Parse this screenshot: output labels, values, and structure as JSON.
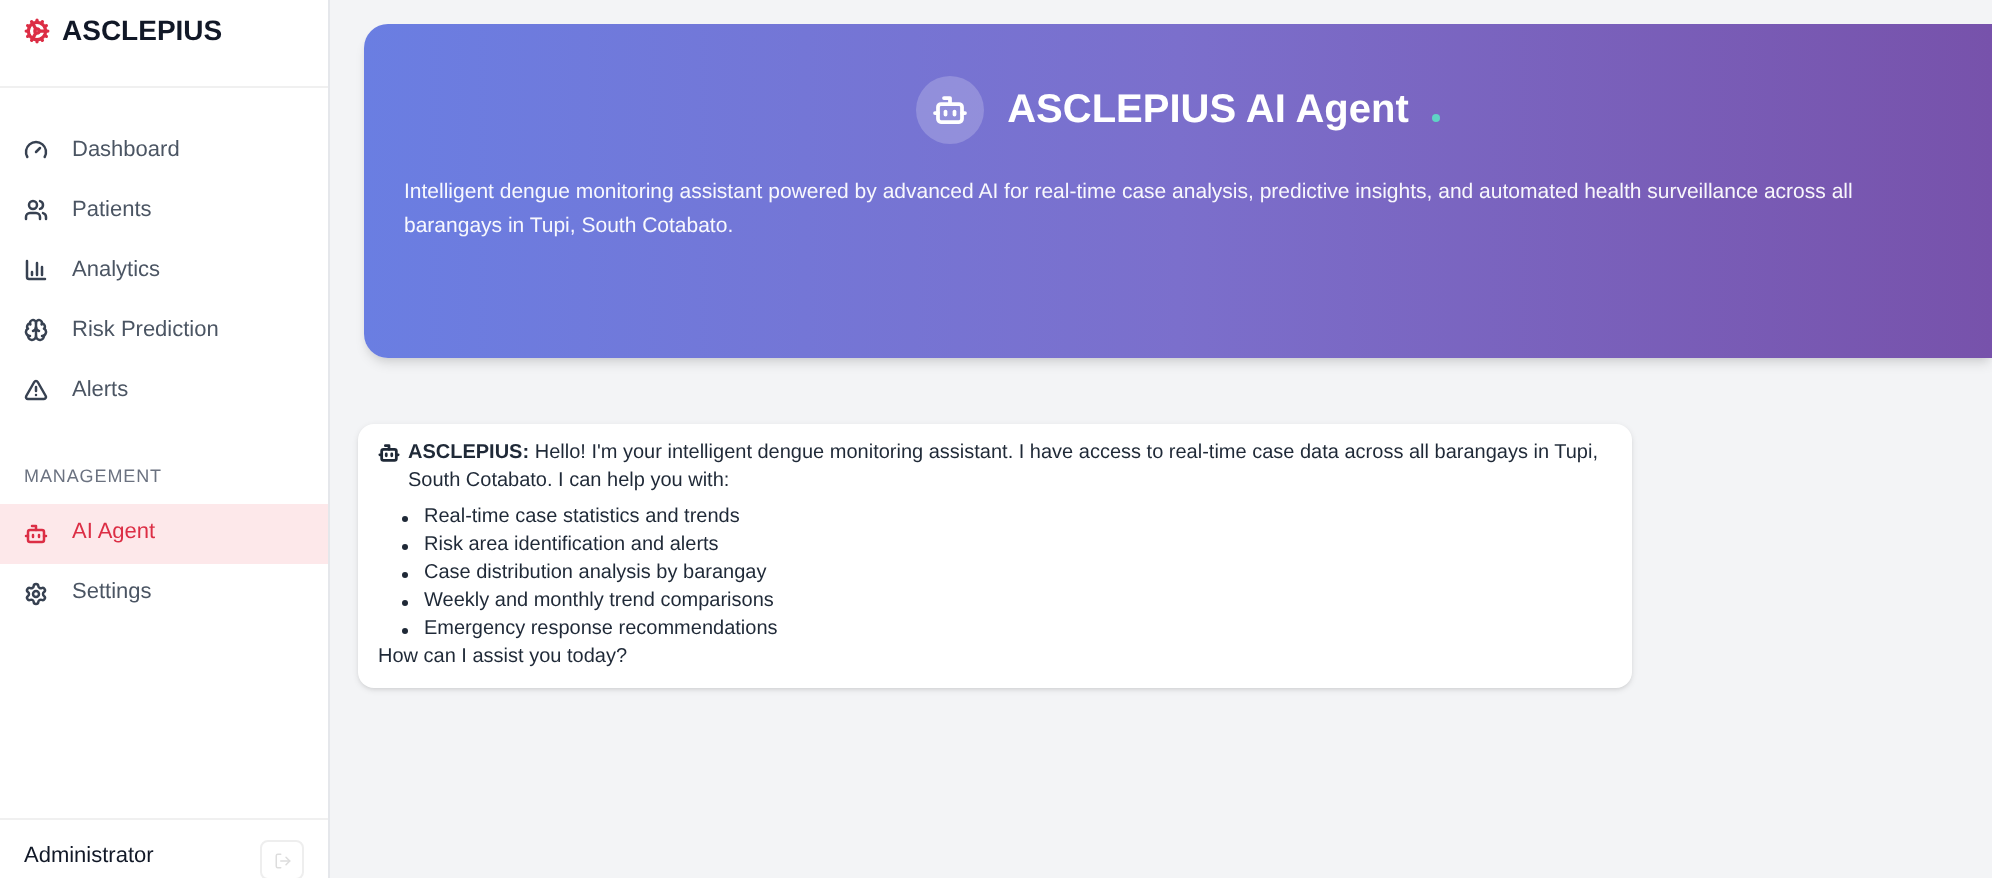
{
  "sidebar": {
    "brand": "ASCLEPIUS",
    "nav": [
      {
        "label": "Dashboard",
        "selected": false
      },
      {
        "label": "Patients",
        "selected": false
      },
      {
        "label": "Analytics",
        "selected": false
      },
      {
        "label": "Risk Prediction",
        "selected": false
      },
      {
        "label": "Alerts",
        "selected": false
      }
    ],
    "section_label": "MANAGEMENT",
    "management": [
      {
        "label": "AI Agent",
        "selected": true
      },
      {
        "label": "Settings",
        "selected": false
      }
    ],
    "user": {
      "name": "Administrator"
    }
  },
  "header": {
    "title": "ASCLEPIUS AI Agent",
    "status_online": true,
    "description": "Intelligent dengue monitoring assistant powered by advanced AI for real-time case analysis, predictive insights, and automated health surveillance across all barangays in Tupi, South Cotabato."
  },
  "messages": [
    {
      "sender": "ASCLEPIUS:",
      "intro": "Hello! I'm your intelligent dengue monitoring assistant. I have access to real-time case data across all barangays in Tupi, South Cotabato. I can help you with:",
      "items": [
        "Real-time case statistics and trends",
        "Risk area identification and alerts",
        "Case distribution analysis by barangay",
        "Weekly and monthly trend comparisons",
        "Emergency response recommendations"
      ],
      "closing": "How can I assist you today?"
    }
  ]
}
